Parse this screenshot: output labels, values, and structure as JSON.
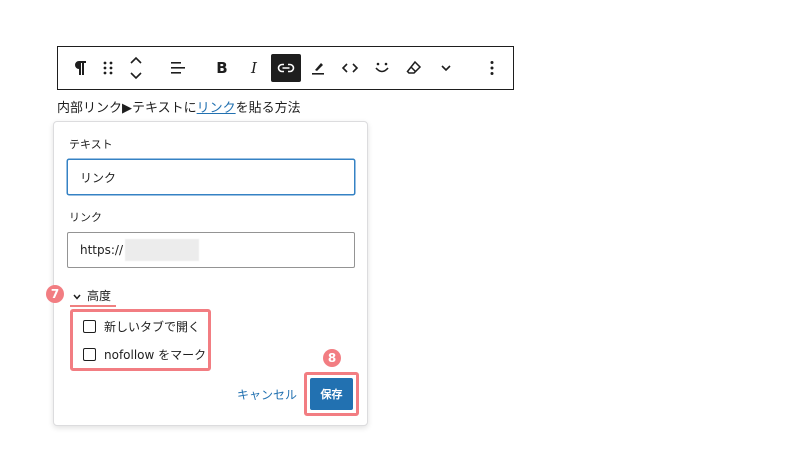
{
  "paragraph": {
    "before": "内部リンク▶テキストに",
    "link_text": "リンク",
    "after": "を貼る方法"
  },
  "toolbar": {
    "icons": [
      "paragraph-icon",
      "drag-handle-icon",
      "move-up-down-icon",
      "align-icon",
      "bold-icon",
      "italic-icon",
      "link-icon",
      "highlight-icon",
      "code-icon",
      "emoji-icon",
      "clear-format-icon",
      "more-chevron-icon",
      "options-icon"
    ],
    "bold_label": "B",
    "italic_label": "I"
  },
  "link_popover": {
    "text_label": "テキスト",
    "text_value": "リンク",
    "link_label": "リンク",
    "link_value": "https://",
    "advanced_label": "高度",
    "open_new_tab_label": "新しいタブで開く",
    "nofollow_label": "nofollow をマーク",
    "cancel_label": "キャンセル",
    "save_label": "保存"
  },
  "annotations": {
    "badge7": "7",
    "badge8": "8"
  },
  "colors": {
    "accent": "#2271b1",
    "highlight": "#f27d82"
  }
}
